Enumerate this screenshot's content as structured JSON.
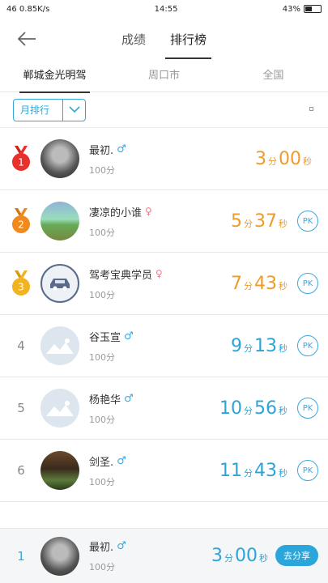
{
  "status": {
    "left": "46  0.85K/s",
    "time": "14:55",
    "battery": "43%"
  },
  "nav": {
    "tabs": [
      "成绩",
      "排行榜"
    ],
    "active": 1
  },
  "sub_tabs": [
    "郸城金光明驾",
    "周口市",
    "全国"
  ],
  "filter": {
    "period": "月排行"
  },
  "colors": {
    "accent": "#2ea4d6",
    "orange": "#ef9b29",
    "gold": "#f2b320",
    "red": "#e8302c",
    "bronze": "#f08a1c"
  },
  "rows": [
    {
      "rank": "1",
      "name": "最初.",
      "gender": "♂",
      "score": "100分",
      "min": "3",
      "sec": "00",
      "pk": "",
      "avatar": "photo-dark"
    },
    {
      "rank": "2",
      "name": "凄凉的小谁",
      "gender": "♀",
      "score": "100分",
      "min": "5",
      "sec": "37",
      "pk": "PK",
      "avatar": "photo-tree"
    },
    {
      "rank": "3",
      "name": "驾考宝典学员",
      "gender": "♀",
      "score": "100分",
      "min": "7",
      "sec": "43",
      "pk": "PK",
      "avatar": "car-icon"
    },
    {
      "rank": "4",
      "name": "谷玉宣",
      "gender": "♂",
      "score": "100分",
      "min": "9",
      "sec": "13",
      "pk": "PK",
      "avatar": "placeholder"
    },
    {
      "rank": "5",
      "name": "杨艳华",
      "gender": "♂",
      "score": "100分",
      "min": "10",
      "sec": "56",
      "pk": "PK",
      "avatar": "placeholder"
    },
    {
      "rank": "6",
      "name": "剑圣.",
      "gender": "♂",
      "score": "100分",
      "min": "11",
      "sec": "43",
      "pk": "PK",
      "avatar": "photo-person"
    }
  ],
  "units": {
    "min": "分",
    "sec": "秒"
  },
  "me": {
    "rank": "1",
    "name": "最初.",
    "gender": "♂",
    "score": "100分",
    "min": "3",
    "sec": "00",
    "share": "去分享"
  }
}
